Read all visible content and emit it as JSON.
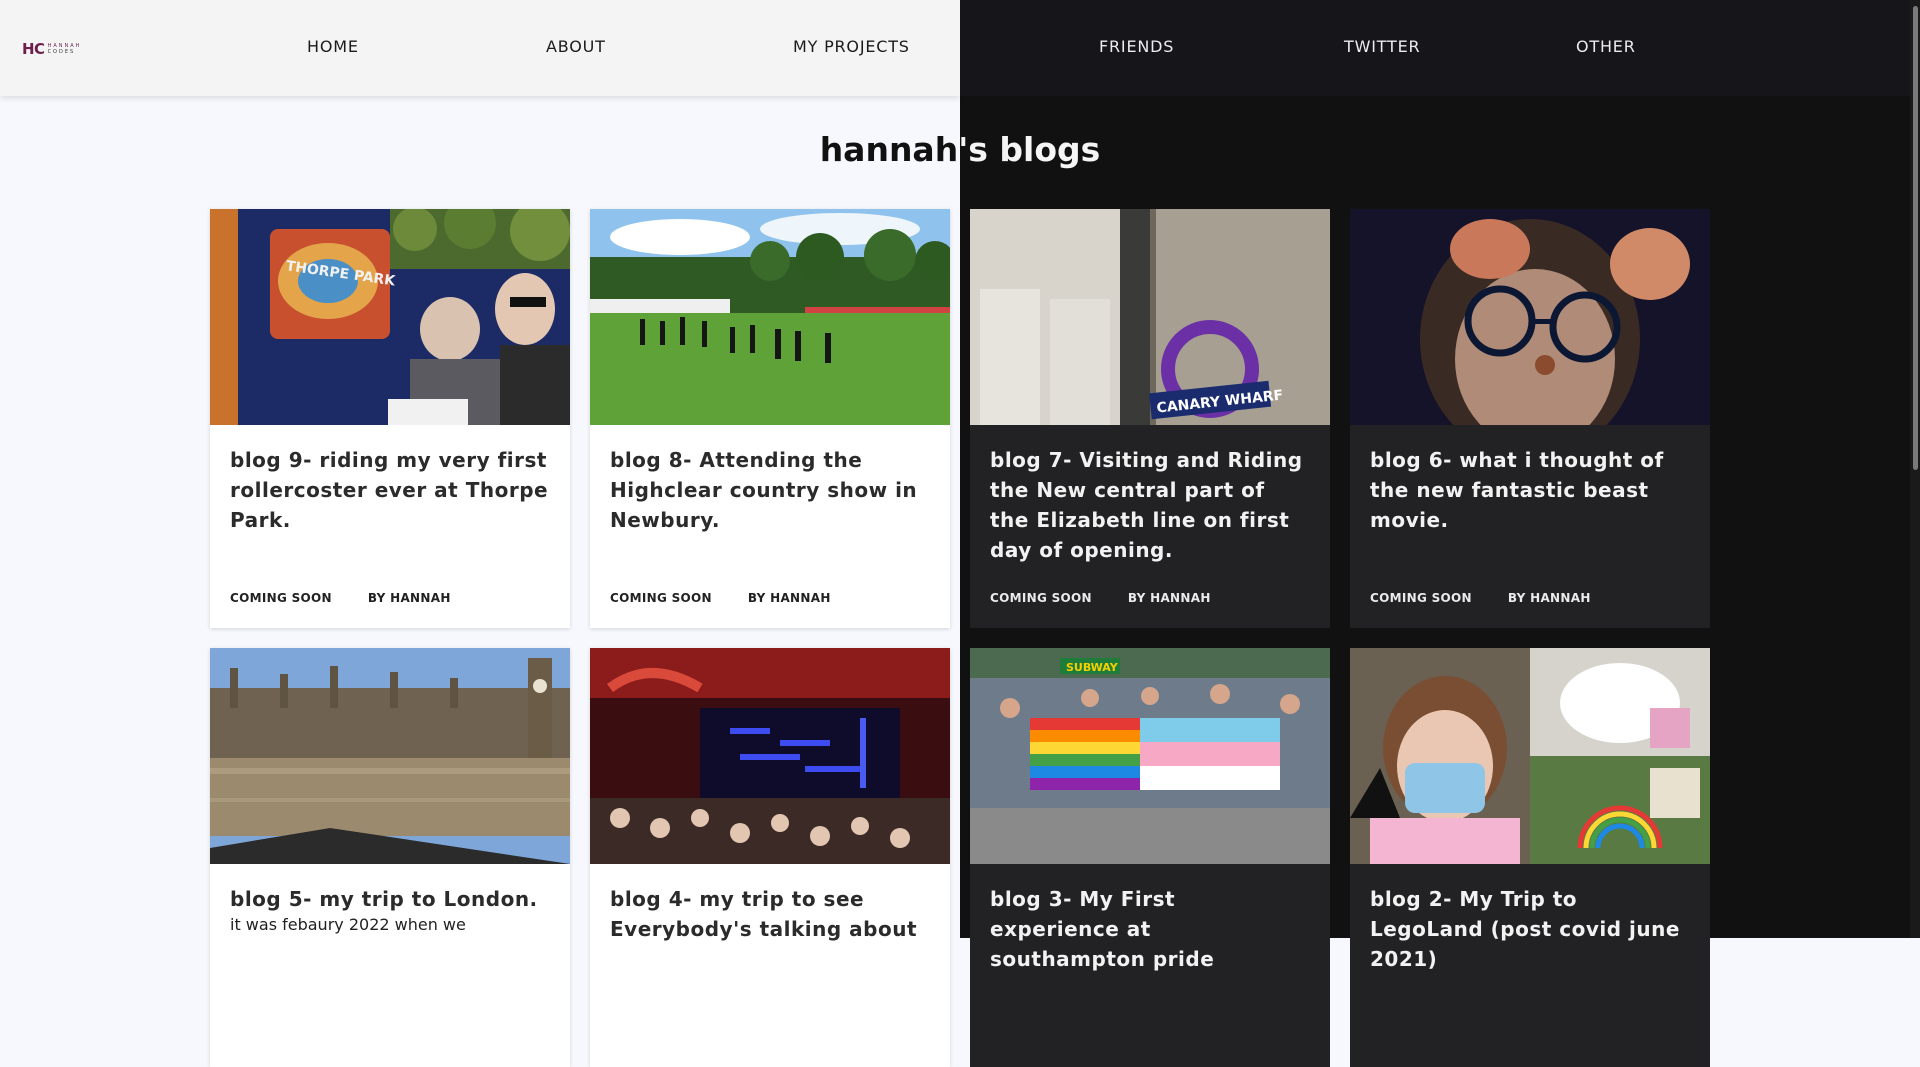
{
  "logo": {
    "mark": "HC",
    "line1": "HANNAH",
    "line2": "CODES"
  },
  "nav": [
    "HOME",
    "ABOUT",
    "MY PROJECTS",
    "FRIENDS",
    "TWITTER",
    "OTHER"
  ],
  "page_title": "hannah's blogs",
  "cards": [
    {
      "title": "blog 9- riding my very first rollercoster ever at Thorpe Park.",
      "status": "COMING SOON",
      "author": "BY HANNAH",
      "image": "thorpe-park-photo-icon"
    },
    {
      "title": "blog 8- Attending the Highclear country show in Newbury.",
      "status": "COMING SOON",
      "author": "BY HANNAH",
      "image": "country-show-photo-icon"
    },
    {
      "title": "blog 7- Visiting and Riding the New central part of the Elizabeth line on first day of opening.",
      "status": "COMING SOON",
      "author": "BY HANNAH",
      "image": "canary-wharf-photo-icon",
      "image_sign": "CANARY WHARF"
    },
    {
      "title": "blog 6- what i thought of the new fantastic beast movie.",
      "status": "COMING SOON",
      "author": "BY HANNAH",
      "image": "selfie-photo-icon"
    },
    {
      "title": "blog 5- my trip to London.",
      "excerpt": "it was febaury 2022 when we",
      "image": "london-photo-icon"
    },
    {
      "title": "blog 4- my trip to see Everybody's talking about",
      "image": "theatre-photo-icon"
    },
    {
      "title": "blog 3- My First experience at southampton pride",
      "image": "pride-photo-icon",
      "image_sign": "SUBWAY"
    },
    {
      "title": "blog 2- My Trip to LegoLand (post covid june 2021)",
      "image": "legoland-photo-icon"
    }
  ]
}
